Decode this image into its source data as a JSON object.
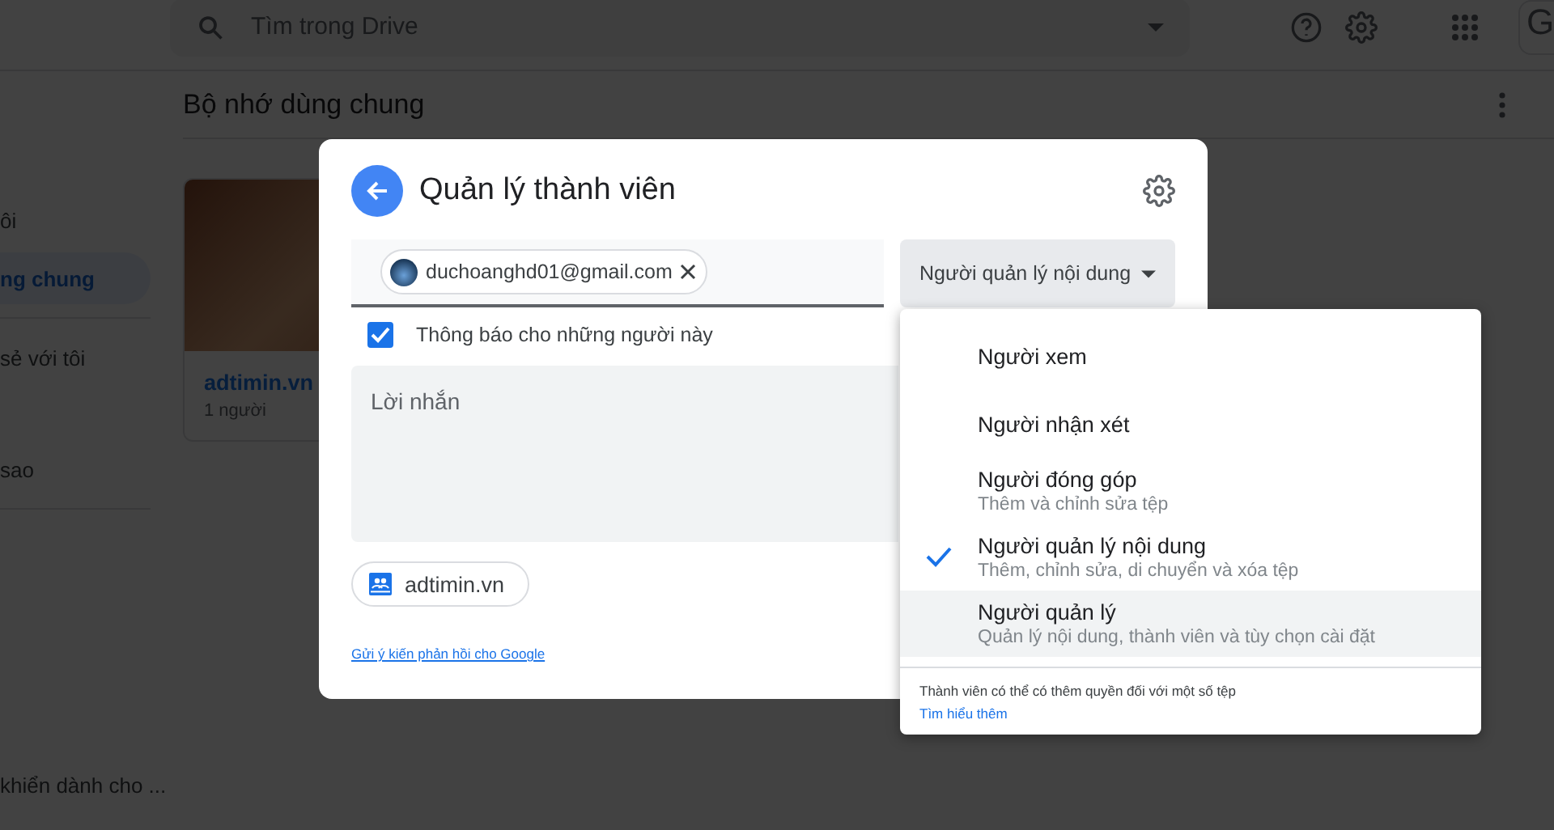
{
  "topbar": {
    "search": {
      "placeholder": "Tìm trong Drive"
    },
    "logo_text": "G"
  },
  "sidebar": {
    "groups": [
      [
        {
          "label": "ôi",
          "selected": false
        },
        {
          "label": "ng chung",
          "selected": true
        }
      ],
      [
        {
          "label": "sẻ với tôi",
          "selected": false
        },
        {
          "label": "sao",
          "selected": false
        }
      ],
      [
        {
          "label": "khiển dành cho ...",
          "selected": false
        }
      ]
    ]
  },
  "header": {
    "title": "Bộ nhớ dùng chung"
  },
  "cards": [
    {
      "title": "adtimin.vn",
      "subtitle": "1 người"
    }
  ],
  "dialog": {
    "title": "Quản lý thành viên",
    "recipients": [
      {
        "email": "duchoanghd01@gmail.com"
      }
    ],
    "role": "Người quản lý nội dung",
    "notify": {
      "label": "Thông báo cho những người này",
      "checked": true
    },
    "message": {
      "placeholder": "Lời nhắn"
    },
    "shared_drive": "adtimin.vn",
    "feedback_link": "Gửi ý kiến phản hồi cho Google"
  },
  "role_menu": {
    "items": [
      {
        "title": "Người xem",
        "selected": false,
        "hovered": false
      },
      {
        "title": "Người nhận xét",
        "selected": false,
        "hovered": false
      },
      {
        "title": "Người đóng góp",
        "subtitle": "Thêm và chỉnh sửa tệp",
        "selected": false,
        "hovered": false
      },
      {
        "title": "Người quản lý nội dung",
        "subtitle": "Thêm, chỉnh sửa, di chuyển và xóa tệp",
        "selected": true,
        "hovered": false
      },
      {
        "title": "Người quản lý",
        "subtitle": "Quản lý nội dung, thành viên và tùy chọn cài đặt",
        "selected": false,
        "hovered": true
      }
    ],
    "note": "Thành viên có thể có thêm quyền đối với một số tệp",
    "learn_more": "Tìm hiểu thêm"
  }
}
